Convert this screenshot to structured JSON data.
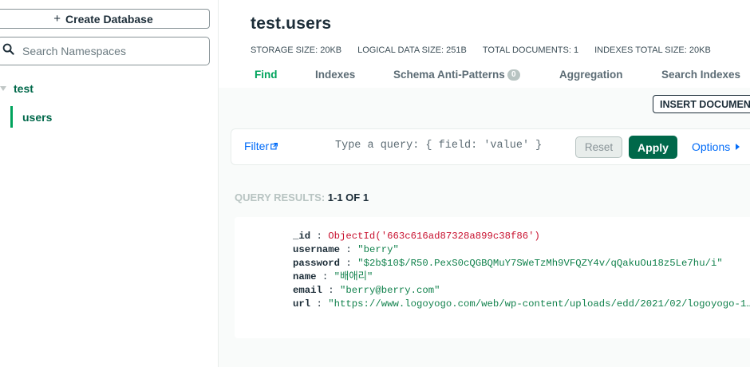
{
  "sidebar": {
    "create_database_label": "Create Database",
    "create_icon": "+",
    "search_placeholder": "Search Namespaces",
    "database": {
      "name": "test"
    },
    "collection": {
      "name": "users"
    }
  },
  "header": {
    "namespace": "test.users",
    "stats": {
      "storage_size": "STORAGE SIZE: 20KB",
      "logical_data_size": "LOGICAL DATA SIZE: 251B",
      "total_documents": "TOTAL DOCUMENTS: 1",
      "indexes_total_size": "INDEXES TOTAL SIZE: 20KB"
    },
    "tabs": [
      {
        "label": "Find",
        "active": true
      },
      {
        "label": "Indexes"
      },
      {
        "label": "Schema Anti-Patterns",
        "badge": "0"
      },
      {
        "label": "Aggregation"
      },
      {
        "label": "Search Indexes"
      }
    ]
  },
  "toolbar": {
    "insert_document_label": "INSERT DOCUMENT"
  },
  "query_bar": {
    "filter_label": "Filter",
    "placeholder": "Type a query: { field: 'value' }",
    "reset_label": "Reset",
    "apply_label": "Apply",
    "options_label": "Options"
  },
  "results": {
    "label": "QUERY RESULTS: ",
    "count": "1-1 OF 1"
  },
  "document": {
    "fields": [
      {
        "key": "_id",
        "value": "ObjectId('663c616ad87328a899c38f86')",
        "type": "oid"
      },
      {
        "key": "username",
        "value": "\"berry\"",
        "type": "string"
      },
      {
        "key": "password",
        "value": "\"$2b$10$/R50.PexS0cQGBQMuY7SWeTzMh9VFQZY4v/qQakuOu18z5Le7hu/i\"",
        "type": "string"
      },
      {
        "key": "name",
        "value": "\"배애리\"",
        "type": "string"
      },
      {
        "key": "email",
        "value": "\"berry@berry.com\"",
        "type": "string"
      },
      {
        "key": "url",
        "value": "\"https://www.logoyogo.com/web/wp-content/uploads/edd/2021/02/logoyogo-1…\"",
        "type": "string"
      }
    ],
    "separator": " : "
  },
  "colors": {
    "accent_green": "#00a35c",
    "dark_green": "#00684a",
    "link_blue": "#016bf8",
    "oid_red": "#c8102e",
    "string_green": "#12824d"
  }
}
